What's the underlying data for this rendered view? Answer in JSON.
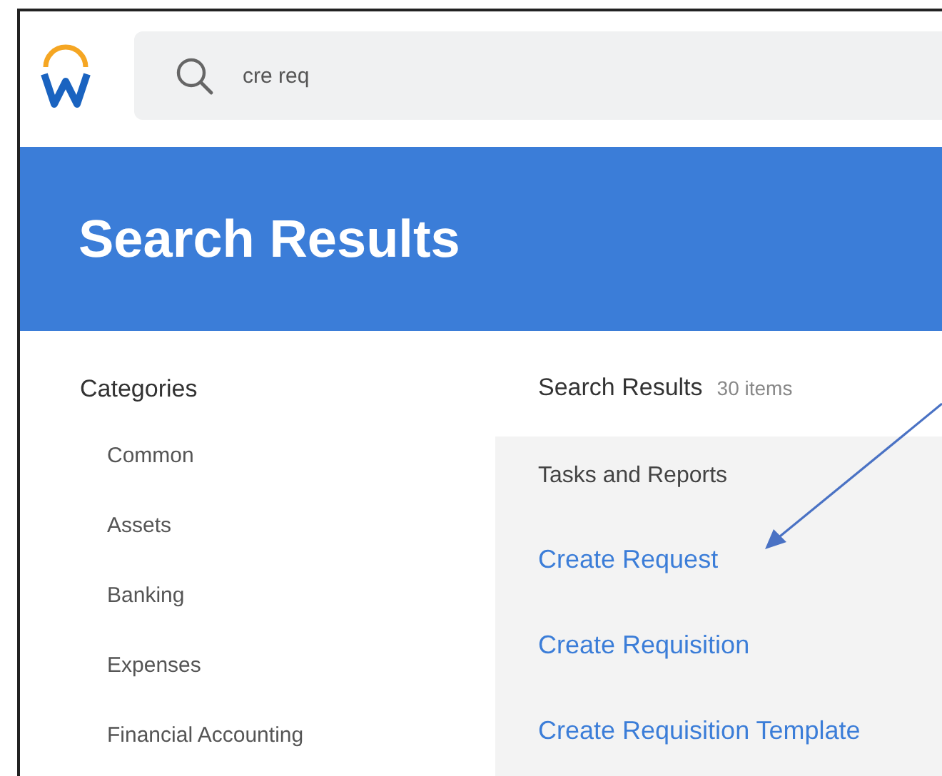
{
  "search": {
    "value": "cre req"
  },
  "banner": {
    "title": "Search Results"
  },
  "categories": {
    "heading": "Categories",
    "items": [
      {
        "label": "Common"
      },
      {
        "label": "Assets"
      },
      {
        "label": "Banking"
      },
      {
        "label": "Expenses"
      },
      {
        "label": "Financial Accounting"
      }
    ]
  },
  "results": {
    "heading": "Search Results",
    "count": "30 items",
    "group": "Tasks and Reports",
    "links": [
      {
        "label": "Create Request"
      },
      {
        "label": "Create Requisition"
      },
      {
        "label": "Create Requisition Template"
      }
    ]
  }
}
